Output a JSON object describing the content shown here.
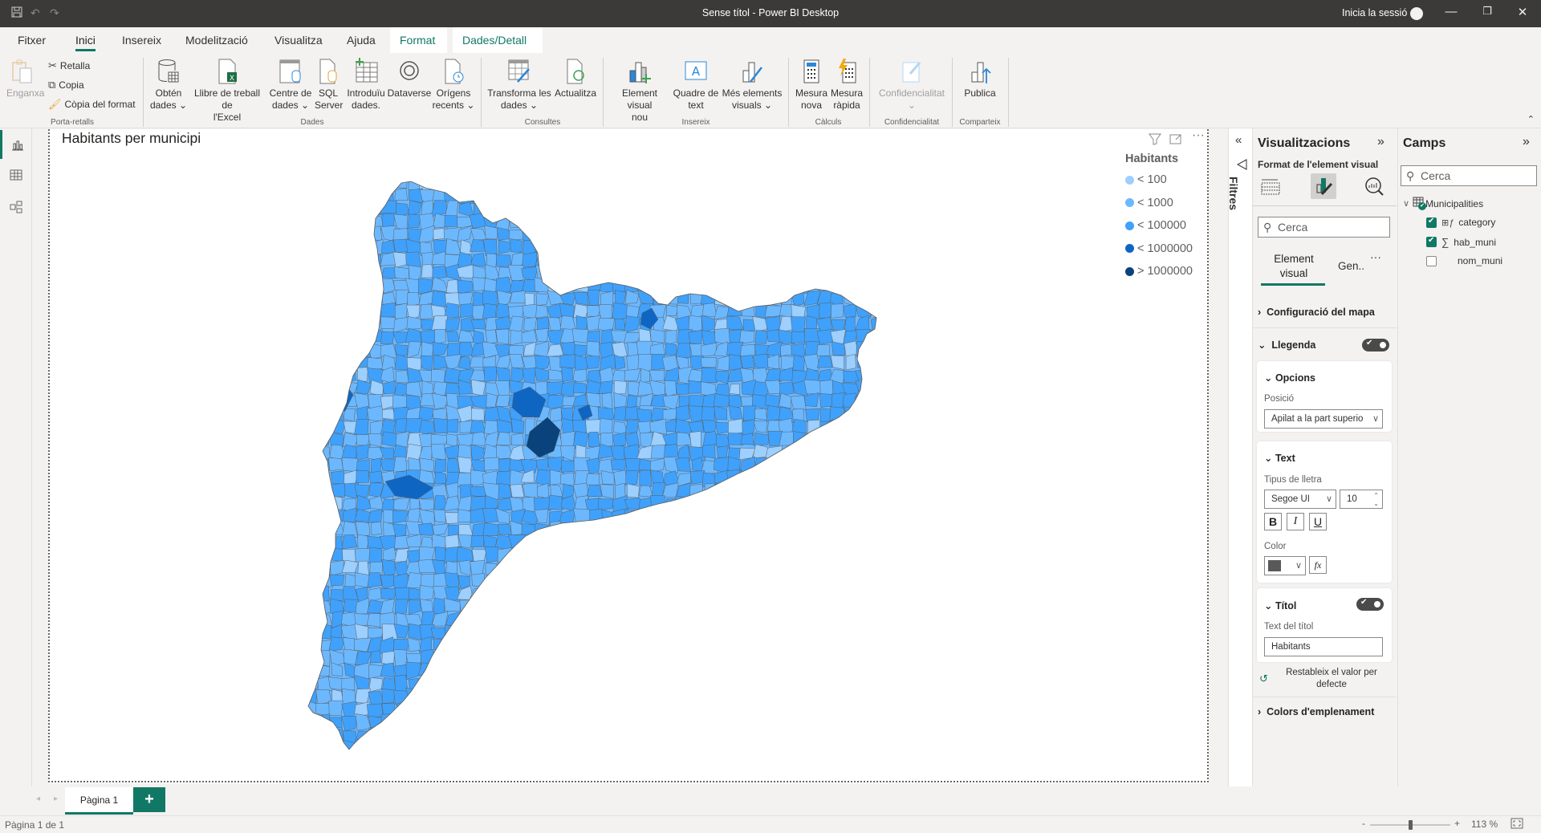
{
  "window": {
    "title": "Sense títol - Power BI Desktop",
    "signin": "Inicia la sessió",
    "quick_access": [
      "save-icon",
      "undo-icon",
      "redo-icon"
    ],
    "controls": [
      "minimize-icon",
      "restore-icon",
      "close-icon"
    ]
  },
  "menu": {
    "tabs": [
      {
        "label": "Fitxer"
      },
      {
        "label": "Inici",
        "active": true
      },
      {
        "label": "Insereix"
      },
      {
        "label": "Modelització"
      },
      {
        "label": "Visualitza"
      },
      {
        "label": "Ajuda"
      },
      {
        "label": "Format",
        "contextual": true
      },
      {
        "label": "Dades/Detall",
        "contextual": true
      }
    ]
  },
  "ribbon": {
    "clipboard": {
      "paste": "Enganxa",
      "cut": "Retalla",
      "copy": "Copia",
      "format_painter": "Còpia del format",
      "group": "Porta-retalls"
    },
    "data": {
      "get_data_1": "Obtén",
      "get_data_2": "dades",
      "excel_1": "Llibre de treball de",
      "excel_2": "l'Excel",
      "hub_1": "Centre de",
      "hub_2": "dades",
      "sql_1": "SQL",
      "sql_2": "Server",
      "enter_1": "Introduïu",
      "enter_2": "dades.",
      "dataverse": "Dataverse",
      "recent_1": "Orígens",
      "recent_2": "recents",
      "group": "Dades"
    },
    "queries": {
      "transform_1": "Transforma les",
      "transform_2": "dades",
      "refresh": "Actualitza",
      "group": "Consultes"
    },
    "insert": {
      "new_visual_1": "Element visual",
      "new_visual_2": "nou",
      "textbox_1": "Quadre de",
      "textbox_2": "text",
      "more_visuals_1": "Més elements",
      "more_visuals_2": "visuals",
      "group": "Insereix"
    },
    "calc": {
      "new_measure_1": "Mesura",
      "new_measure_2": "nova",
      "quick_measure_1": "Mesura",
      "quick_measure_2": "ràpida",
      "group": "Càlculs"
    },
    "sensitivity": {
      "label": "Confidencialitat",
      "group": "Confidencialitat"
    },
    "share": {
      "publish": "Publica",
      "group": "Comparteix"
    }
  },
  "visual": {
    "title": "Habitants per municipi",
    "legend": {
      "title": "Habitants",
      "items": [
        {
          "label": "< 100",
          "color": "#9dcfff"
        },
        {
          "label": "< 1000",
          "color": "#6cb8ff"
        },
        {
          "label": "< 100000",
          "color": "#3fa1fb"
        },
        {
          "label": "< 1000000",
          "color": "#0f66c2"
        },
        {
          "label": "> 1000000",
          "color": "#0a437c"
        }
      ]
    },
    "map_region": "Catalunya",
    "header_icons": [
      "filter-icon",
      "focus-mode-icon",
      "more-options-icon"
    ]
  },
  "filters": {
    "label": "Filtres"
  },
  "visualizations": {
    "title": "Visualitzacions",
    "subtitle": "Format de l'element visual",
    "search_placeholder": "Cerca",
    "tabs": [
      {
        "label": "Element visual",
        "active": true
      },
      {
        "label": "Gen.."
      }
    ],
    "sections": {
      "map_settings": "Configuració del mapa",
      "legend": "Llegenda",
      "legend_on": true,
      "options": "Opcions",
      "position_label": "Posició",
      "position_value": "Apilat a la part superio",
      "text": "Text",
      "font_label": "Tipus de lletra",
      "font_value": "Segoe UI",
      "font_size": "10",
      "bold": "B",
      "italic": "I",
      "underline": "U",
      "color_label": "Color",
      "color_value": "#595959",
      "fx": "fx",
      "title": "Títol",
      "title_on": true,
      "title_text_label": "Text del títol",
      "title_text_value": "Habitants",
      "reset_1": "Restableix el valor per",
      "reset_2": "defecte",
      "fill_colors": "Colors d'emplenament"
    }
  },
  "fields": {
    "title": "Camps",
    "search_placeholder": "Cerca",
    "table": "Municipalities",
    "items": [
      {
        "name": "category",
        "checked": true,
        "icon": "calculated-column-icon"
      },
      {
        "name": "hab_muni",
        "checked": true,
        "icon": "sigma-icon"
      },
      {
        "name": "nom_muni",
        "checked": false,
        "icon": ""
      }
    ]
  },
  "pages": {
    "tabs": [
      "Pàgina 1"
    ],
    "add": "+"
  },
  "status": {
    "page": "Pàgina 1 de 1",
    "zoom": "113 %",
    "zoom_level": 0.5
  }
}
